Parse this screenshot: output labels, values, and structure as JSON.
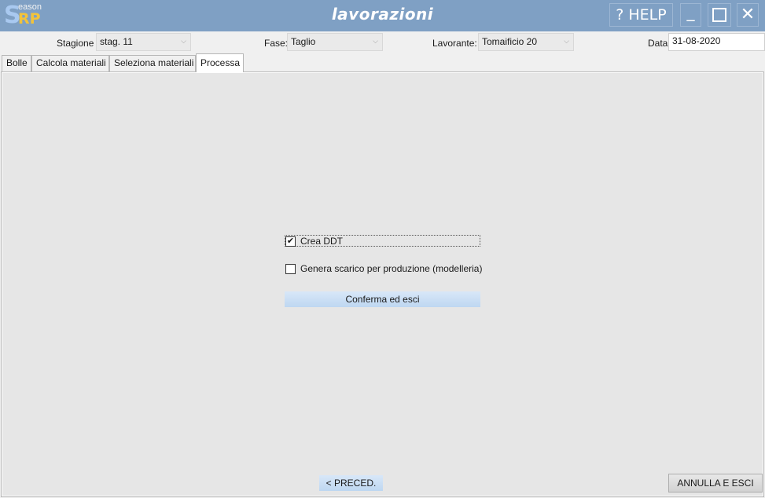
{
  "app": {
    "logo": {
      "letter": "S",
      "top_text": "eason",
      "bottom_text": "RP"
    },
    "title": "lavorazioni",
    "help_label": "? HELP",
    "minimize_label": "_",
    "close_label": "✕"
  },
  "filters": {
    "stagione": {
      "label": "Stagione",
      "value": "stag. 11"
    },
    "fase": {
      "label": "Fase:",
      "value": "Taglio"
    },
    "lavorante": {
      "label": "Lavorante:",
      "value": "Tomaificio 20"
    },
    "data": {
      "label": "Data",
      "value": "31-08-2020"
    },
    "dropdown_glyph": "⌵"
  },
  "tabs": [
    {
      "label": "Bolle"
    },
    {
      "label": "Calcola materiali"
    },
    {
      "label": "Seleziona materiali"
    },
    {
      "label": "Processa",
      "active": true
    }
  ],
  "process": {
    "crea_ddt": {
      "label": "Crea DDT",
      "checked": true,
      "mark": "✔"
    },
    "genera_scarico": {
      "label": "Genera scarico per produzione (modelleria)",
      "checked": false,
      "mark": ""
    },
    "confirm_label": "Conferma ed esci"
  },
  "footer": {
    "prev_label": "< PRECED.",
    "cancel_label": "ANNULLA E ESCI"
  }
}
